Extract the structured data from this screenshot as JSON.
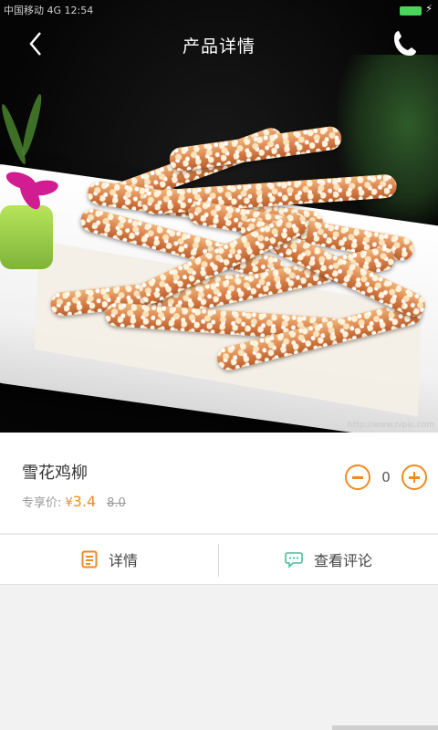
{
  "status_bar": {
    "carrier_text": "中国移动 4G  12:54"
  },
  "header": {
    "title": "产品详情"
  },
  "hero": {
    "watermark": "http://www.nipic.com"
  },
  "product": {
    "name": "雪花鸡柳",
    "price_label": "专享价:",
    "currency": "¥",
    "price": "3.4",
    "original_price": "8.0",
    "quantity": "0"
  },
  "tabs": [
    {
      "label": "详情",
      "icon": "document-icon"
    },
    {
      "label": "查看评论",
      "icon": "comment-icon"
    }
  ],
  "colors": {
    "accent": "#f08a22",
    "comment_icon": "#4dbb9d"
  }
}
